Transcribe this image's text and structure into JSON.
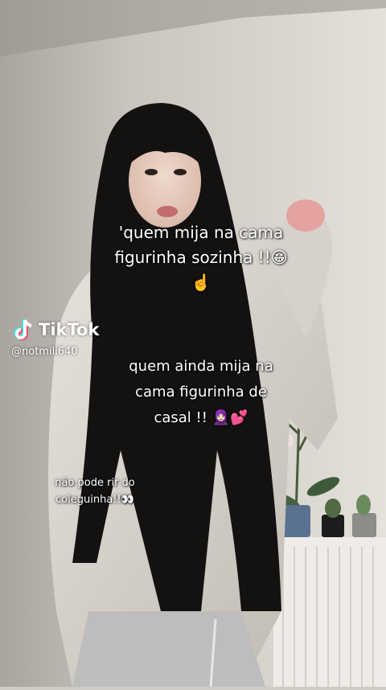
{
  "captions": {
    "main": {
      "lines": [
        "'quem mija na cama",
        "figurinha sozinha !!😀",
        "☝️"
      ]
    },
    "second": {
      "lines": [
        "quem ainda mija na",
        "cama figurinha de",
        "casal !! 🧕🏻💕"
      ]
    },
    "third": {
      "lines": [
        "não pode rir do",
        "coleguinha!!👀"
      ]
    }
  },
  "watermark": {
    "app": "TikTok",
    "username": "@notmili640",
    "logo_icon": "tiktok-logo-icon"
  },
  "colors": {
    "wall": "#cfcac4",
    "hair": "#141210",
    "jacket": "#dcd8d0",
    "text": "#ffffff"
  }
}
